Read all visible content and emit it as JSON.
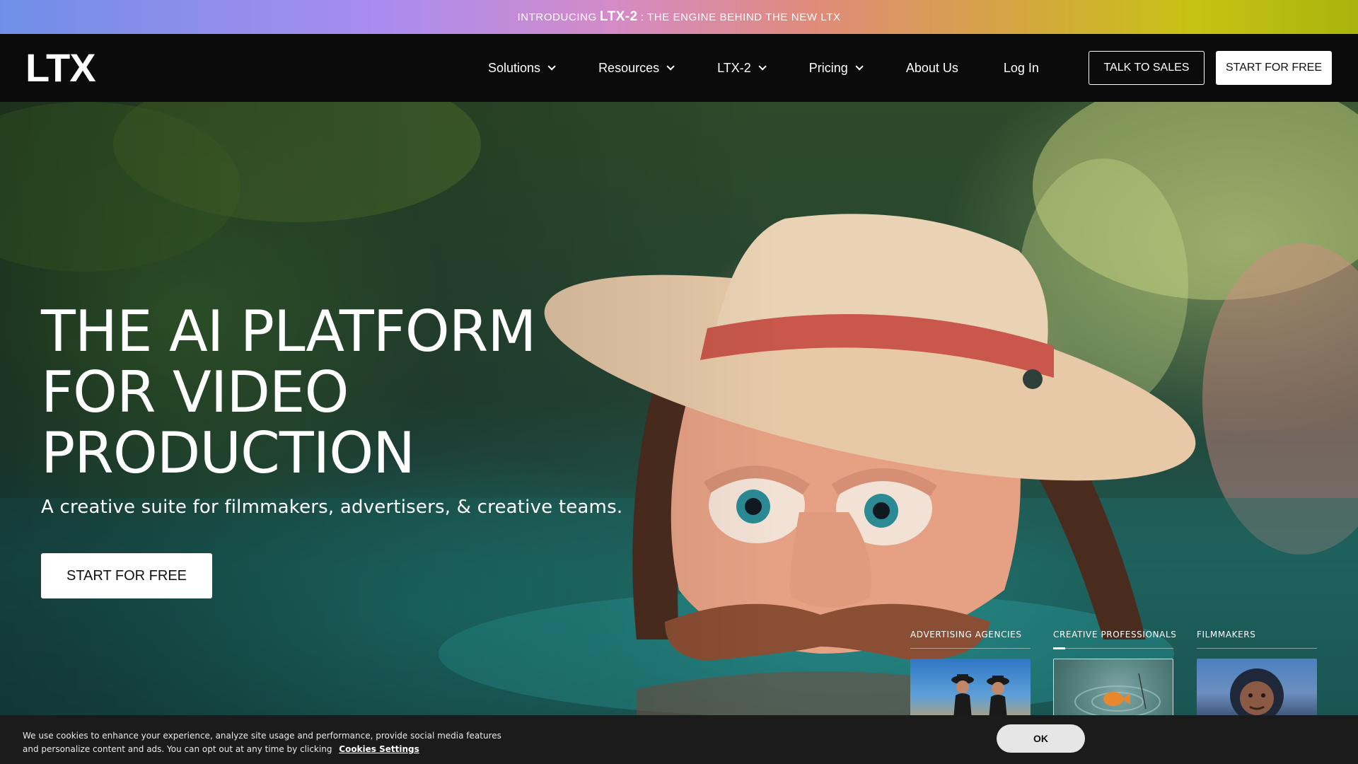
{
  "announcement": {
    "prefix": "INTRODUCING",
    "brand": "LTX-2",
    "suffix": ": THE ENGINE BEHIND THE NEW LTX"
  },
  "nav": {
    "logo": "LTX",
    "menu": [
      {
        "label": "Solutions",
        "dropdown": true
      },
      {
        "label": "Resources",
        "dropdown": true
      },
      {
        "label": "LTX-2",
        "dropdown": true
      },
      {
        "label": "Pricing",
        "dropdown": true
      },
      {
        "label": "About Us",
        "dropdown": false
      },
      {
        "label": "Log In",
        "dropdown": false
      }
    ],
    "talk_to_sales": "TALK TO SALES",
    "start_for_free": "START FOR FREE"
  },
  "hero": {
    "headline": [
      "THE AI PLATFORM",
      "FOR VIDEO",
      "PRODUCTION"
    ],
    "subheadline": "A creative suite for filmmakers, advertisers, & creative teams.",
    "cta": "START FOR FREE"
  },
  "audiences": [
    {
      "label": "ADVERTISING AGENCIES",
      "active": false,
      "progress": 0
    },
    {
      "label": "CREATIVE PROFESSIONALS",
      "active": true,
      "progress": 0.1
    },
    {
      "label": "FILMMAKERS",
      "active": false,
      "progress": 0
    }
  ],
  "cookie": {
    "text": "We use cookies to enhance your experience, analyze site usage and performance, provide social media features and personalize content and ads. You can opt out at any time by clicking",
    "link": "Cookies Settings",
    "ok": "OK"
  },
  "colors": {
    "nav_bg": "#0b0b0b",
    "cookie_bg": "#1b1b1b",
    "button_bg": "#ffffff"
  }
}
